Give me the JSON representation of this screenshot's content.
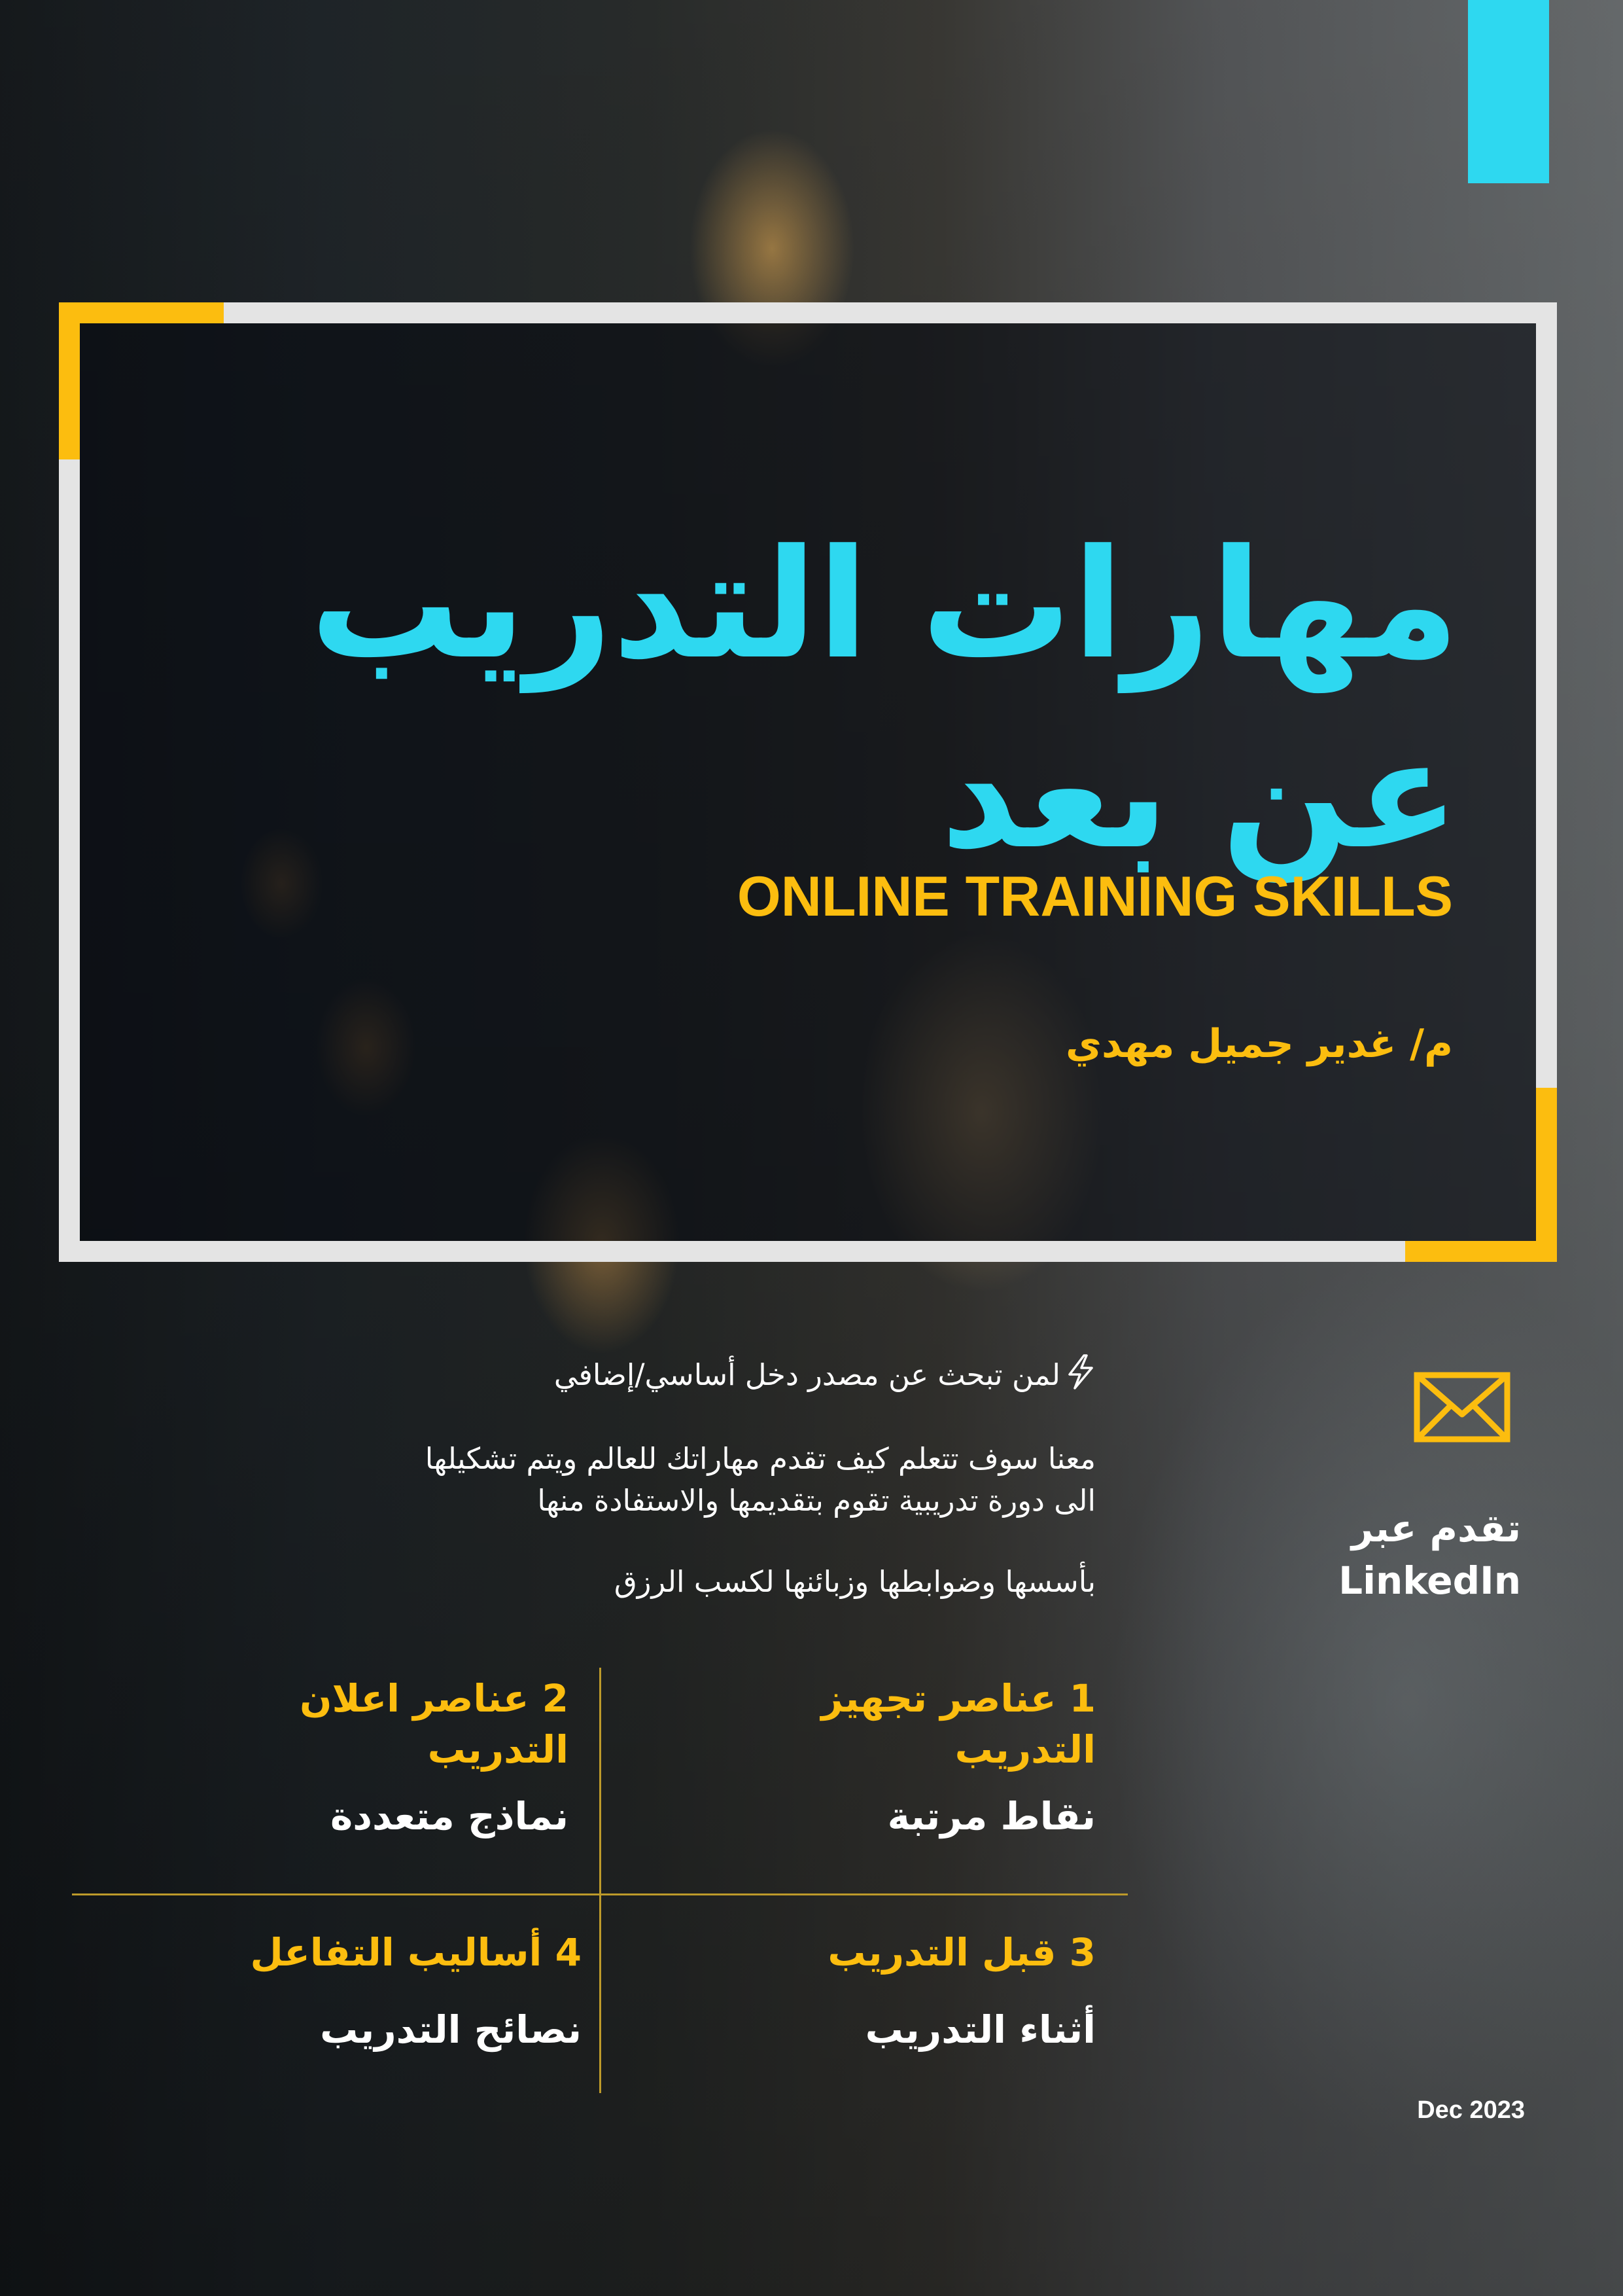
{
  "colors": {
    "cyan": "#2ed8f0",
    "yellow": "#fcbd0f",
    "frame": "#e4e4e4",
    "text": "#ffffff"
  },
  "header": {
    "title_line1": "مهارات التدريب",
    "title_line2": "عن بعد",
    "subtitle": "ONLINE TRAINING SKILLS",
    "author": "م/ غدير جميل مهدي"
  },
  "intro": {
    "bolt_icon": "lightning-icon",
    "line1": "لمن تبحث عن مصدر دخل أساسي/إضافي",
    "line2": "معنا سوف تتعلم كيف تقدم مهاراتك للعالم ويتم تشكيلها",
    "line3": "الى دورة تدريبية تقوم بتقديمها والاستفادة منها",
    "line4": "بأسسها وضوابطها وزبائنها لكسب الرزق"
  },
  "contact": {
    "icon": "envelope-icon",
    "line1": "تقدم عبر",
    "line2": "LinkedIn"
  },
  "grid": [
    {
      "heading": "1 عناصر تجهيز التدريب",
      "value": "نقاط مرتبة"
    },
    {
      "heading": "2 عناصر اعلان التدريب",
      "value": "نماذج متعددة"
    },
    {
      "heading": "3 قبل التدريب",
      "value": "أثناء التدريب"
    },
    {
      "heading": "4 أساليب التفاعل",
      "value": "نصائح التدريب"
    }
  ],
  "footer": {
    "date": "Dec 2023"
  }
}
